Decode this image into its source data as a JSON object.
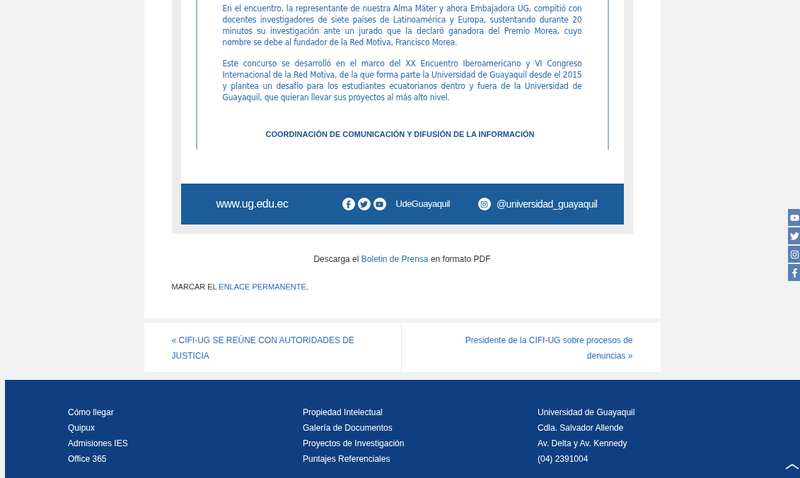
{
  "bulletin": {
    "paragraphs": [
      "En el encuentro, la representante de nuestra Alma Máter y ahora Embajadora UG, compitió con docentes investigadores de siete países de Latinoamérica y Europa, sustentando durante 20 minutos su investigación ante un jurado que la declaró ganadora del Premio Morea, cuyo nombre se debe al fundador de la Red Motiva, Francisco Morea.",
      "Este concurso se desarrolló en el marco del XX Encuentro Iberoamericano y VI Congreso Internacional de la Red Motiva, de la que forma parte la Universidad de Guayaquil desde el 2015 y plantea un desafío para los estudiantes ecuatorianos dentro y fuera de la Universidad de Guayaquil, que quieran llevar sus proyectos al más alto nivel."
    ],
    "signature": "COORDINACIÓN DE COMUNICACIÓN Y DIFUSIÓN DE LA INFORMACIÓN",
    "band": {
      "website": "www.ug.edu.ec",
      "social_handle": "UdeGuayaquil",
      "instagram": "@universidad_guayaquil"
    }
  },
  "download": {
    "before": "Descarga el",
    "link": "Boletin de Prensa",
    "after": "en formato PDF"
  },
  "permalink": {
    "label": "MARCAR EL",
    "link": "ENLACE PERMANENTE",
    "end": "."
  },
  "post_nav": {
    "previous": "« CIFI-UG SE REÚNE CON AUTORIDADES DE JUSTICIA",
    "next": "Presidente de la CIFI-UG sobre procesos de denuncias »"
  },
  "side_share": [
    {
      "kind": "youtube"
    },
    {
      "kind": "twitter"
    },
    {
      "kind": "instagram"
    },
    {
      "kind": "facebook"
    }
  ],
  "footer": {
    "columns": [
      [
        "Cómo llegar",
        "Quipux",
        "Admisiones IES",
        "Office 365"
      ],
      [
        "Propiedad Intelectual",
        "Galería de Documentos",
        "Proyectos de Investigación",
        "Puntajes Referenciales"
      ],
      [
        "Universidad de Guayaquil",
        "Cdla. Salvador Allende",
        "Av. Delta y Av. Kennedy",
        "(04) 2391004"
      ]
    ]
  }
}
